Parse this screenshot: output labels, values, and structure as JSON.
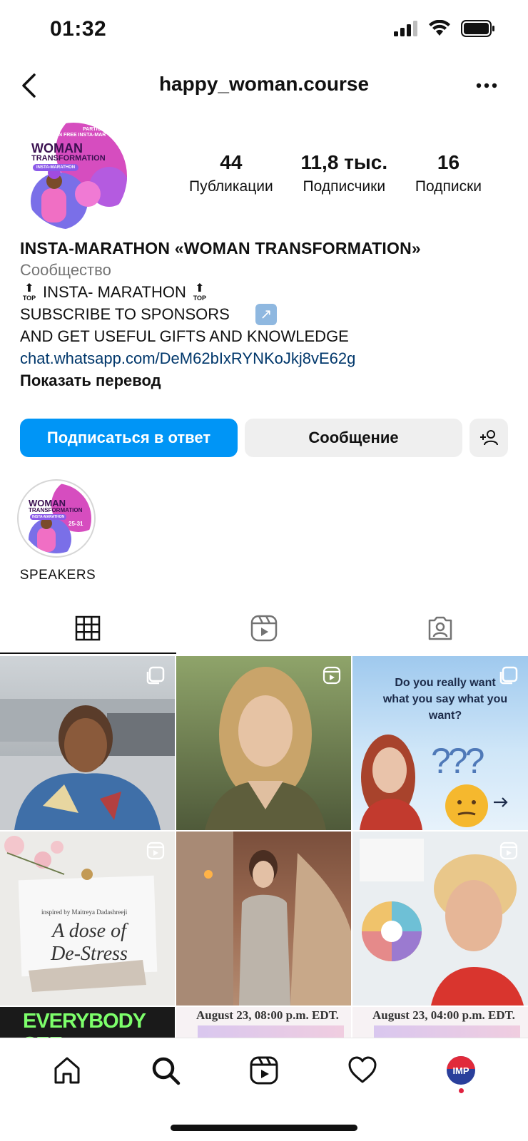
{
  "status_bar": {
    "time": "01:32"
  },
  "header": {
    "username": "happy_woman.course"
  },
  "avatar": {
    "line1": "PARTICI",
    "line2": "IN FREE INSTA-MAR",
    "title1": "WOMAN",
    "title2": "TRANSFORMATION",
    "badge": "INSTA-MARATHON"
  },
  "stats": [
    {
      "value": "44",
      "label": "Публикации"
    },
    {
      "value": "11,8 тыс.",
      "label": "Подписчики"
    },
    {
      "value": "16",
      "label": "Подписки"
    }
  ],
  "bio": {
    "name": "INSTA-MARATHON «WOMAN TRANSFORMATION»",
    "category": "Сообщество",
    "line1": "INSTA- MARATHON",
    "top_label": "TOP",
    "line2": "SUBSCRIBE TO SPONSORS",
    "line3": "AND GET USEFUL GIFTS AND KNOWLEDGE",
    "link": "chat.whatsapp.com/DeM62bIxRYNKoJkj8vE62g",
    "translate": "Показать перевод"
  },
  "actions": {
    "follow_back": "Подписаться в ответ",
    "message": "Сообщение"
  },
  "highlight": {
    "label": "SPEAKERS",
    "title1": "WOMAN",
    "title2": "TRANSFORMATION",
    "badge": "INSTA-MARATHON",
    "dates": "25-31"
  },
  "posts": {
    "p3_text": "Do you really want what you say what you want?",
    "p3_marks": "???",
    "p4_small": "inspired by Maitreya Dadashreeji",
    "p4_title": "A dose of De-Stress",
    "p7_text": "EVERYBODY SEE",
    "p8_text": "August 23, 08:00 p.m. EDT.",
    "p9_text": "August 23, 04:00 p.m. EDT."
  },
  "bottom_nav": {
    "profile_initials": "IMP"
  },
  "colors": {
    "accent": "#0095f6",
    "link": "#00376b",
    "brand_pink": "#d64dbf"
  }
}
